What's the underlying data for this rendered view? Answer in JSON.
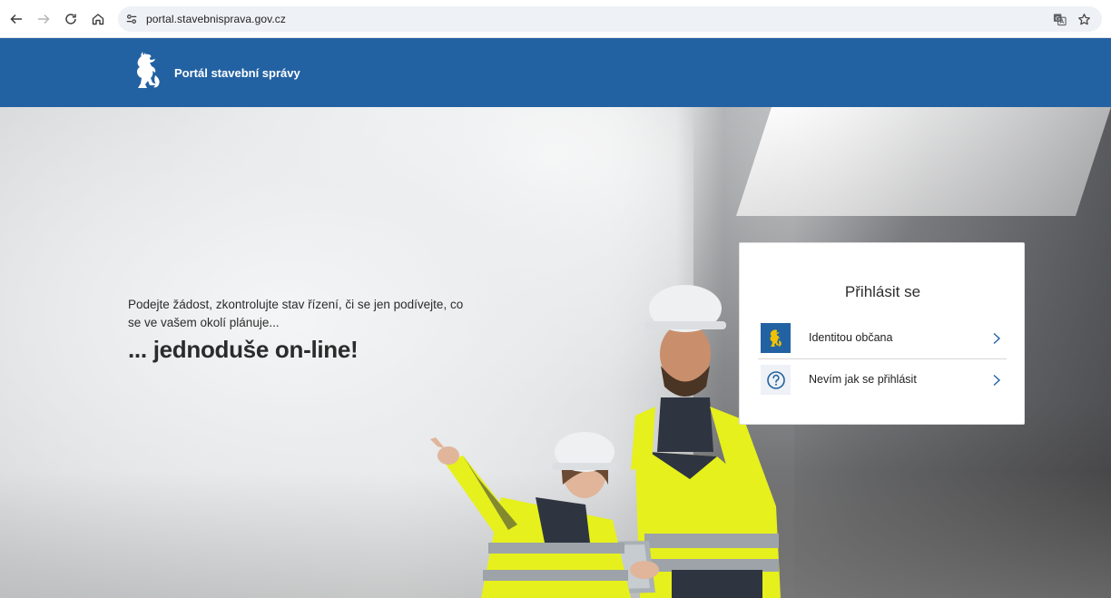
{
  "browser": {
    "url": "portal.stavebnisprava.gov.cz",
    "back_icon": "arrow-left-icon",
    "forward_icon": "arrow-right-icon",
    "reload_icon": "reload-icon",
    "home_icon": "home-icon",
    "site_info_icon": "tune-icon",
    "translate_icon": "translate-icon",
    "bookmark_icon": "star-icon"
  },
  "header": {
    "logo_icon": "czech-lion-icon",
    "title": "Portál stavební správy",
    "background_color": "#2362a2"
  },
  "hero": {
    "subtitle": "Podejte žádost, zkontrolujte stav řízení, či se jen podívejte, co se ve vašem okolí plánuje...",
    "headline": "... jednoduše on-line!"
  },
  "login": {
    "title": "Přihlásit se",
    "options": [
      {
        "label": "Identitou občana",
        "icon": "czech-lion-icon"
      },
      {
        "label": "Nevím jak se přihlásit",
        "icon": "question-circle-icon"
      }
    ],
    "accent_color": "#2362a2"
  }
}
